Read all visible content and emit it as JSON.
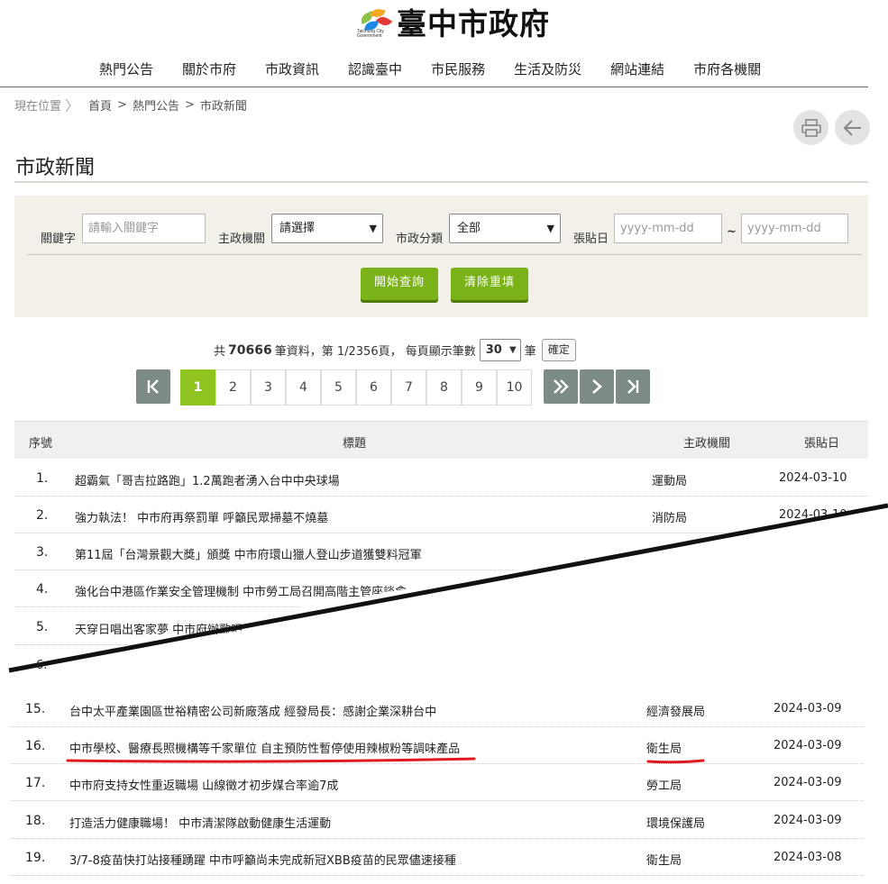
{
  "header": {
    "logo_caption": "Taichung City Government",
    "site_title": "臺中市政府"
  },
  "nav": [
    {
      "label": "熱門公告"
    },
    {
      "label": "關於市府"
    },
    {
      "label": "市政資訊"
    },
    {
      "label": "認識臺中"
    },
    {
      "label": "市民服務"
    },
    {
      "label": "生活及防災"
    },
    {
      "label": "網站連結"
    },
    {
      "label": "市府各機關"
    }
  ],
  "breadcrumb": {
    "here": "現在位置",
    "items": [
      "首頁",
      "熱門公告",
      "市政新聞"
    ]
  },
  "icons": {
    "print": "printer-icon",
    "back": "arrow-left-icon"
  },
  "page_title": "市政新聞",
  "search": {
    "keyword_label": "關鍵字",
    "keyword_placeholder": "請輸入關鍵字",
    "agency_label": "主政機關",
    "agency_value": "請選擇",
    "category_label": "市政分類",
    "category_value": "全部",
    "date_label": "張貼日",
    "date_from_placeholder": "yyyy-mm-dd",
    "date_sep": "~",
    "date_to_placeholder": "yyyy-mm-dd",
    "submit_label": "開始查詢",
    "reset_label": "清除重填"
  },
  "summary": {
    "prefix": "共",
    "total": "70666",
    "mid": "筆資料，第 1/2356頁， 每頁顯示筆數",
    "per_page": "30",
    "unit": "筆",
    "confirm_label": "確定"
  },
  "pager": {
    "first": "K",
    "pages": [
      "1",
      "2",
      "3",
      "4",
      "5",
      "6",
      "7",
      "8",
      "9",
      "10"
    ],
    "current": "1",
    "next_group": "»",
    "next": "›",
    "last": "›|"
  },
  "table": {
    "headers": {
      "no": "序號",
      "title": "標題",
      "agency": "主政機關",
      "date": "張貼日"
    },
    "rows_top": [
      {
        "no": "1.",
        "title": "超霸氣「哥吉拉路跑」1.2萬跑者湧入台中中央球場",
        "agency": "運動局",
        "date": "2024-03-10"
      },
      {
        "no": "2.",
        "title": "強力執法！ 中市府再祭罰單 呼籲民眾掃墓不燒墓",
        "agency": "消防局",
        "date": "2024-03-10"
      },
      {
        "no": "3.",
        "title": "第11屆「台灣景觀大獎」頒獎 中市府環山獵人登山步道獲雙料冠軍",
        "agency": "",
        "date": ""
      },
      {
        "no": "4.",
        "title": "強化台中港區作業安全管理機制 中市勞工局召開高階主管座談會",
        "agency": "",
        "date": ""
      },
      {
        "no": "5.",
        "title": "天穿日唱出客家夢 中市府辦歌唱",
        "agency": "",
        "date": ""
      },
      {
        "no": "6.",
        "title": "",
        "agency": "",
        "date": ""
      }
    ],
    "rows_bottom": [
      {
        "no": "15.",
        "title": "台中太平產業園區世裕精密公司新廠落成 經發局長：感謝企業深耕台中",
        "agency": "經濟發展局",
        "date": "2024-03-09"
      },
      {
        "no": "16.",
        "title": "中市學校、醫療長照機構等千家單位 自主預防性暫停使用辣椒粉等調味產品",
        "agency": "衛生局",
        "date": "2024-03-09"
      },
      {
        "no": "17.",
        "title": "中市府支持女性重返職場 山線徵才初步媒合率逾7成",
        "agency": "勞工局",
        "date": "2024-03-09"
      },
      {
        "no": "18.",
        "title": "打造活力健康職場！ 中市清潔隊啟動健康生活運動",
        "agency": "環境保護局",
        "date": "2024-03-09"
      },
      {
        "no": "19.",
        "title": "3/7-8疫苗快打站接種踴躍 中市呼籲尚未完成新冠XBB疫苗的民眾儘速接種",
        "agency": "衛生局",
        "date": "2024-03-08"
      }
    ]
  },
  "annotation_color": "#e0191f"
}
